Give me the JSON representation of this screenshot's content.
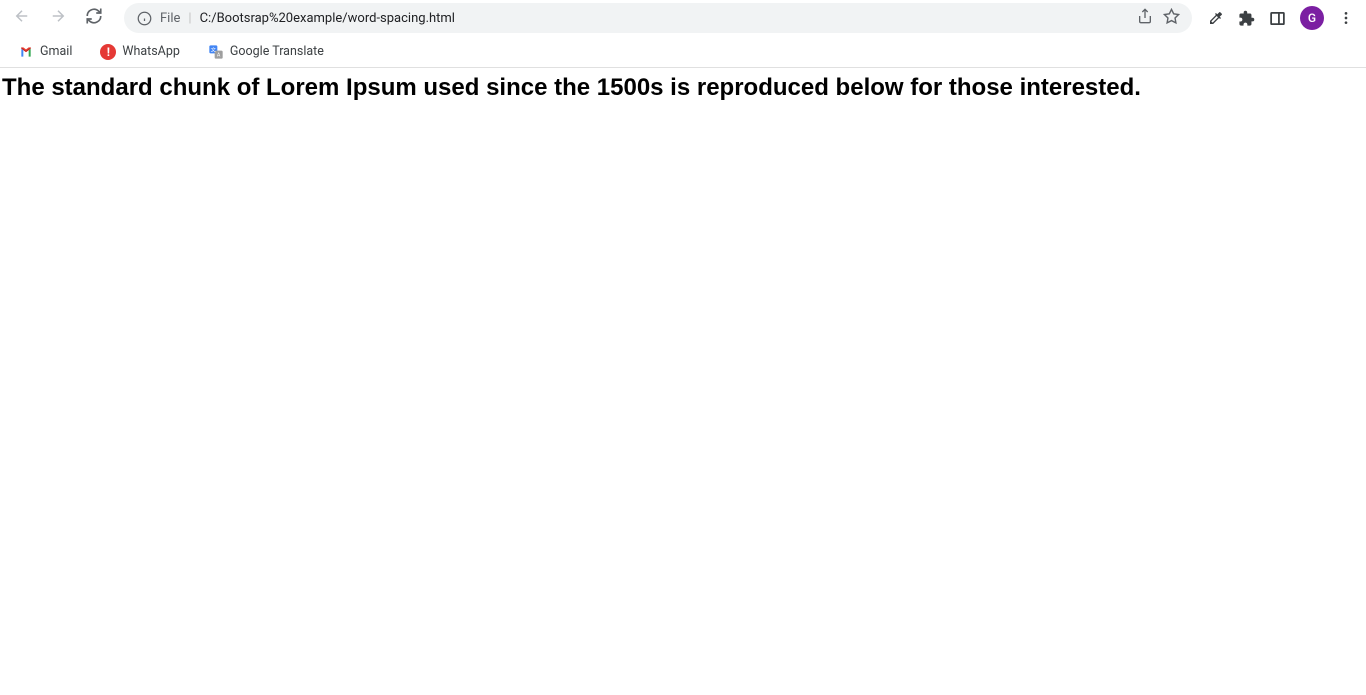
{
  "toolbar": {
    "url_prefix": "File",
    "url": "C:/Bootsrap%20example/word-spacing.html",
    "avatar_letter": "G"
  },
  "bookmarks": {
    "items": [
      {
        "label": "Gmail"
      },
      {
        "label": "WhatsApp"
      },
      {
        "label": "Google Translate"
      }
    ]
  },
  "page": {
    "text": "The standard chunk of Lorem Ipsum used since the 1500s is reproduced below for those interested."
  }
}
